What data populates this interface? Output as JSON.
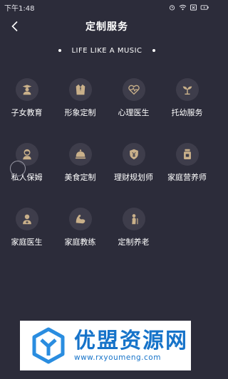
{
  "status_bar": {
    "time": "下午1:48",
    "icons": [
      "alarm-icon",
      "wifi-icon",
      "sim-card-icon",
      "battery-icon"
    ]
  },
  "nav": {
    "title": "定制服务",
    "back_icon": "chevron-left-icon"
  },
  "slogan": "LIFE LIKE A MUSIC",
  "colors": {
    "background": "#2c2c3a",
    "icon_circle": "#3e3d4b",
    "icon_gold": "#c9b08a",
    "banner_blue": "#1673c9"
  },
  "services": [
    {
      "label": "子女教育",
      "icon": "graduate-icon"
    },
    {
      "label": "形象定制",
      "icon": "suit-icon"
    },
    {
      "label": "心理医生",
      "icon": "heart-pulse-icon"
    },
    {
      "label": "托幼服务",
      "icon": "sprout-icon"
    },
    {
      "label": "私人保姆",
      "icon": "nanny-icon"
    },
    {
      "label": "美食定制",
      "icon": "food-cloche-icon"
    },
    {
      "label": "理财规划师",
      "icon": "shield-coin-icon"
    },
    {
      "label": "家庭营养师",
      "icon": "nutrition-jar-icon"
    },
    {
      "label": "家庭医生",
      "icon": "doctor-icon"
    },
    {
      "label": "家庭教练",
      "icon": "muscle-arm-icon"
    },
    {
      "label": "定制养老",
      "icon": "elder-icon"
    }
  ],
  "banner": {
    "title": "优盟资源网",
    "url": "www.rxyoumeng.com"
  }
}
